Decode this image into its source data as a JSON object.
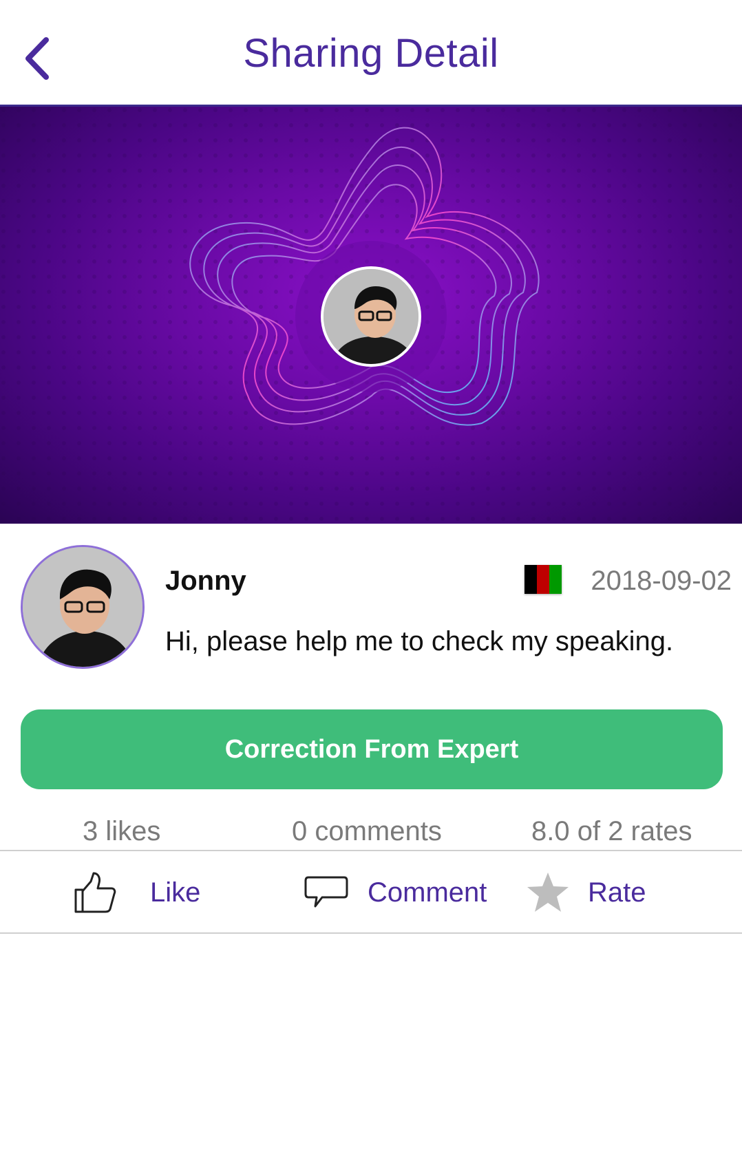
{
  "header": {
    "title": "Sharing Detail",
    "back_icon": "chevron-left-icon"
  },
  "post": {
    "username": "Jonny",
    "date": "2018-09-02",
    "message": "Hi, please help me to check my speaking.",
    "flag_colors": [
      "#000000",
      "#be0000",
      "#009900"
    ]
  },
  "expert_button": {
    "label": "Correction From Expert"
  },
  "stats": {
    "likes": "3 likes",
    "comments": "0 comments",
    "rates": "8.0 of 2 rates"
  },
  "actions": [
    {
      "label": "Like",
      "icon": "thumbs-up-icon"
    },
    {
      "label": "Comment",
      "icon": "speech-bubble-icon"
    },
    {
      "label": "Rate",
      "icon": "star-icon"
    }
  ],
  "colors": {
    "accent": "#4a2b9d",
    "button_green": "#3fbd7a",
    "muted": "#7a7a7a"
  }
}
